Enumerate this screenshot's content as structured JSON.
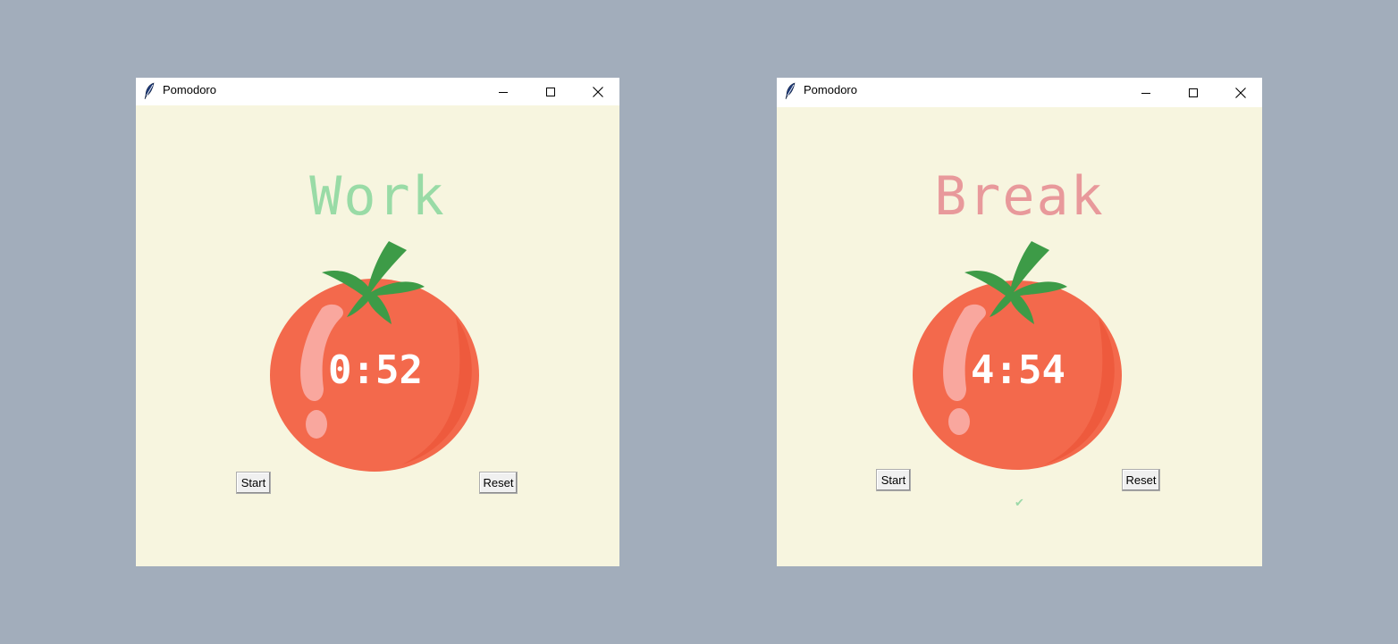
{
  "windows": [
    {
      "title": "Pomodoro",
      "mode_label": "Work",
      "mode_color": "#99dba6",
      "timer": "0:52",
      "start_label": "Start",
      "reset_label": "Reset",
      "checkmarks": ""
    },
    {
      "title": "Pomodoro",
      "mode_label": "Break",
      "mode_color": "#e8999b",
      "timer": "4:54",
      "start_label": "Start",
      "reset_label": "Reset",
      "checkmarks": "✔"
    }
  ],
  "colors": {
    "desktop": "#a2adbb",
    "window_bg": "#f7f5df",
    "tomato_body": "#f3694c",
    "tomato_shade": "#ee5a3d",
    "tomato_stem": "#3d9b47",
    "highlight": "#f9a79e"
  },
  "icons": {
    "app_icon": "feather-icon",
    "minimize": "minimize-icon",
    "maximize": "maximize-icon",
    "close": "close-icon"
  }
}
